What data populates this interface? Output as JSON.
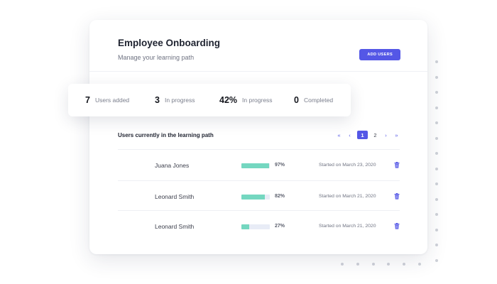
{
  "card": {
    "title": "Employee Onboarding",
    "subtitle": "Manage your learning path",
    "add_button": "ADD USERS"
  },
  "stats": [
    {
      "value": "7",
      "label": "Users added"
    },
    {
      "value": "3",
      "label": "In progress"
    },
    {
      "value": "42%",
      "label": "In progress"
    },
    {
      "value": "0",
      "label": "Completed"
    }
  ],
  "list": {
    "title": "Users currently in the learning path",
    "pagination": {
      "first": "«",
      "prev": "‹",
      "pages": [
        "1",
        "2"
      ],
      "current": "1",
      "next": "›",
      "last": "»"
    }
  },
  "rows": [
    {
      "name": "Juana Jones",
      "progress": 97,
      "progress_label": "97%",
      "started": "Started on March 23, 2020"
    },
    {
      "name": "Leonard Smith",
      "progress": 82,
      "progress_label": "82%",
      "started": "Started on March 21, 2020"
    },
    {
      "name": "Leonard Smith",
      "progress": 27,
      "progress_label": "27%",
      "started": "Started on March 21, 2020"
    }
  ],
  "colors": {
    "accent": "#5457e6",
    "progress": "#74d7c0",
    "track": "#e8ecf6"
  },
  "icons": {
    "delete": "trash-icon"
  }
}
